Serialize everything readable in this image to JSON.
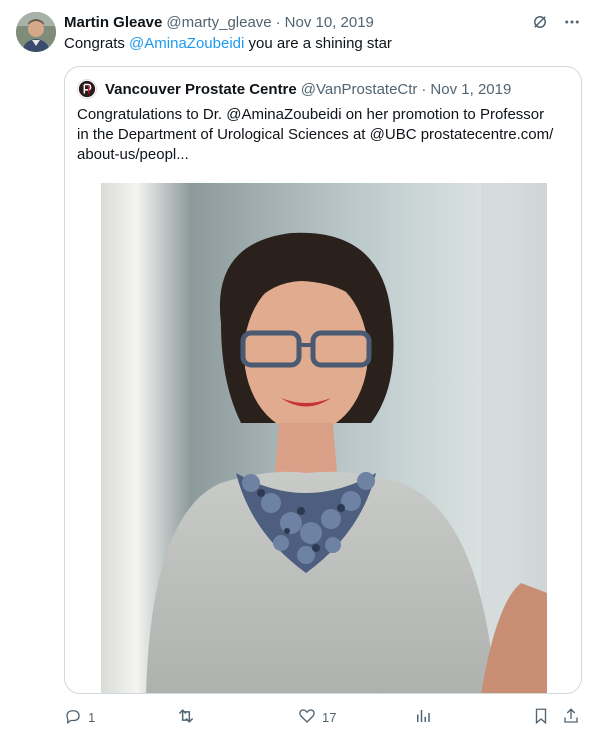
{
  "tweet": {
    "author_name": "Martin Gleave",
    "author_handle": "@marty_gleave",
    "separator": "·",
    "date": "Nov 10, 2019",
    "text_prefix": "Congrats ",
    "mention": "@AminaZoubeidi",
    "text_suffix": " you are a shining star"
  },
  "quoted": {
    "author_name": "Vancouver Prostate Centre",
    "author_handle": "@VanProstateCtr",
    "separator": "·",
    "date": "Nov 1, 2019",
    "text_lines": [
      "Congratulations to Dr. @AminaZoubeidi on her promotion to Professor",
      "in the Department of Urological Sciences at @UBC prostatecentre.com/",
      "about-us/peopl..."
    ]
  },
  "actions": {
    "reply_count": "1",
    "retweet_count": "",
    "like_count": "17"
  },
  "colors": {
    "link": "#1d9bf0",
    "muted": "#536471",
    "border": "#cfd9de"
  },
  "icons": [
    "grok-icon",
    "more-icon",
    "reply-icon",
    "retweet-icon",
    "like-icon",
    "views-icon",
    "bookmark-icon",
    "share-icon"
  ]
}
